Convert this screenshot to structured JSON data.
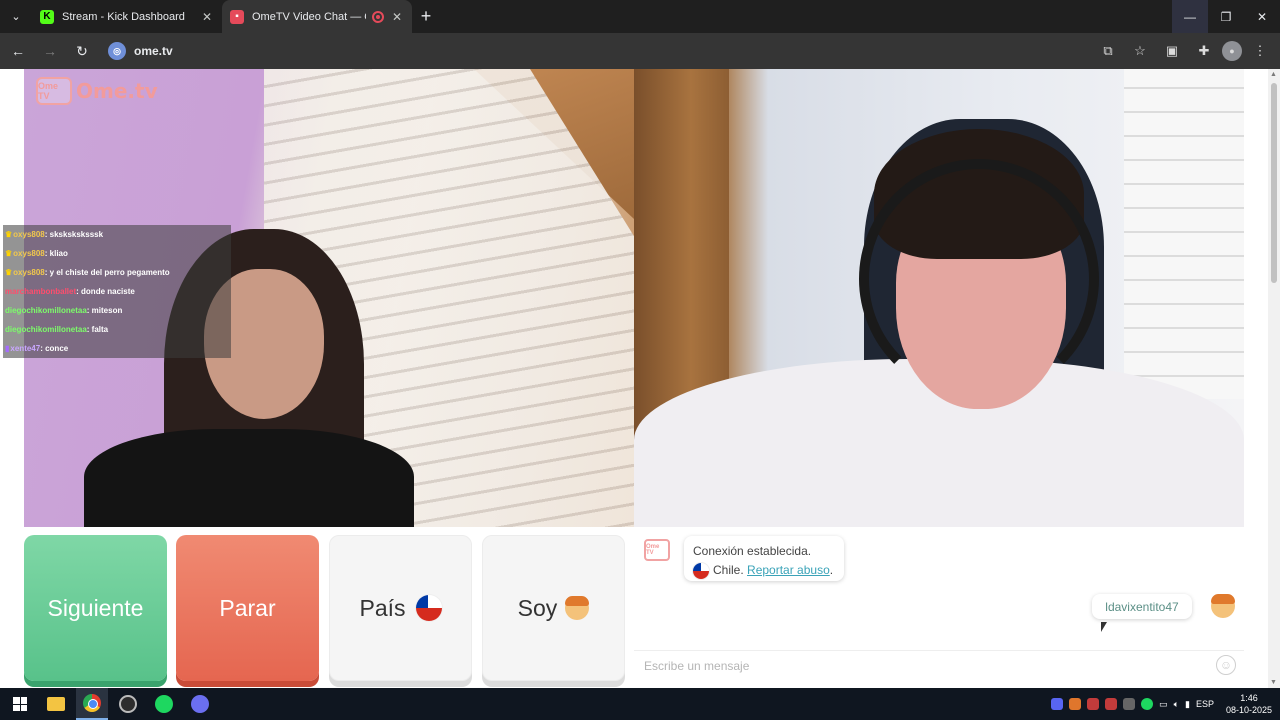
{
  "browser": {
    "tabs": [
      {
        "title": "Stream - Kick Dashboard",
        "favicon": "kick-icon",
        "active": false
      },
      {
        "title": "OmeTV Video Chat — Ome",
        "favicon": "ometv-icon",
        "active": true
      }
    ],
    "url": "ome.tv"
  },
  "page": {
    "logo_text": "Ome.tv",
    "logo_badge": "Ome TV"
  },
  "stream_chat": [
    {
      "user": "oxys808",
      "message": ": sksksksksssk"
    },
    {
      "user": "oxys808",
      "message": ": kliao"
    },
    {
      "user": "oxys808",
      "message": ": y el chiste del perro pegamento"
    },
    {
      "user": "marchambonballet",
      "message": ": donde naciste"
    },
    {
      "user": "diegochikomillonetaa",
      "message": ": miteson"
    },
    {
      "user": "diegochikomillonetaa",
      "message": ": falta"
    },
    {
      "user": "xente47",
      "message": ": conce"
    }
  ],
  "controls": {
    "next_label": "Siguiente",
    "stop_label": "Parar",
    "country_label": "País",
    "gender_label": "Soy"
  },
  "chat": {
    "system_line1": "Conexión establecida.",
    "system_country": "Chile.",
    "report_link": "Reportar abuso",
    "report_suffix": ".",
    "my_message": "ldavixentito47",
    "input_placeholder": "Escribe un mensaje"
  },
  "taskbar": {
    "language": "ESP",
    "time": "1:46",
    "date": "08-10-2025"
  },
  "colors": {
    "next": "#58c28a",
    "stop": "#e56650",
    "link": "#3aa3b8"
  }
}
